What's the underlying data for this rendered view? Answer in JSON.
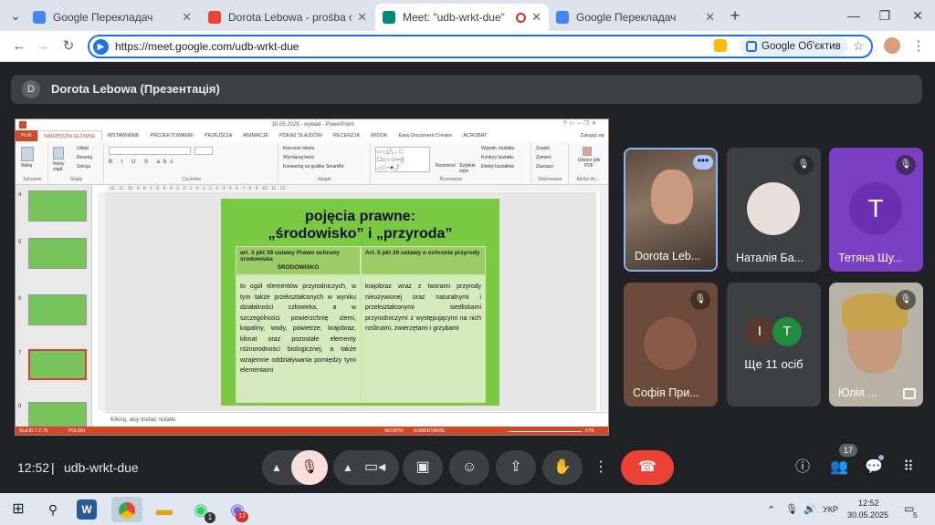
{
  "browser": {
    "tabs": [
      {
        "title": "Google Перекладач",
        "color": "#4285f4"
      },
      {
        "title": "Dorota Lebowa - prośba o można",
        "color": "#ea4335"
      },
      {
        "title": "Meet: \"udb-wrkt-due\"",
        "color": "#00897b"
      },
      {
        "title": "Google Перекладач",
        "color": "#4285f4"
      }
    ],
    "url": "https://meet.google.com/udb-wrkt-due",
    "lens_label": "Google Об'єктив",
    "new_tab": "+",
    "close": "✕"
  },
  "presenter": {
    "initial": "D",
    "name": "Dorota Lebowa (Презентація)"
  },
  "powerpoint": {
    "window_title": "30.05.2025 - wykład - PowerPoint",
    "tabs": [
      "PLIK",
      "NARZĘDZIA GŁÓWNE",
      "WSTAWIANIE",
      "PROJEKTOWANIE",
      "PRZEJŚCIA",
      "ANIMACJE",
      "POKAZ SLAJDÓW",
      "RECENZJA",
      "WIDOK",
      "Easy Document Creator",
      "ACROBAT"
    ],
    "login": "Zaloguj się",
    "ribbon_groups": [
      "Schowek",
      "Slajdy",
      "Czcionka",
      "Akapit",
      "Rysowanie",
      "Edytowanie",
      "Adobe Ac..."
    ],
    "ribbon_buttons": {
      "paste": "Wklej",
      "new_slide": "Nowy slajd",
      "layout": "Układ",
      "reset": "Resetuj",
      "section": "Sekcja",
      "text_direction": "Kierunek tekstu",
      "align_text": "Wyrównaj tekst",
      "smartart": "Konwertuj na grafikę SmartArt",
      "arrange": "Rozmieść",
      "quick_styles": "Szybkie style",
      "fill": "Wypełn. kształtu",
      "outline": "Kontury kształtu",
      "effects": "Efekty kształtów",
      "find": "Znajdź",
      "replace": "Zamień",
      "select": "Zaznacz",
      "pdf": "Utwórz plik PDF"
    },
    "thumbnails": [
      "4",
      "5",
      "6",
      "7",
      "8"
    ],
    "notes_placeholder": "Kliknij, aby dodać notatki",
    "status": {
      "slide": "SLAJD 7 Z 79",
      "lang": "POLSKI",
      "notes": "NOTATKI",
      "comments": "KOMENTARZE",
      "zoom": "67%"
    }
  },
  "slide": {
    "title_line1": "pojęcia prawne:",
    "title_line2": "„środowisko” i „przyroda”",
    "header_left": "art. 3 pkt 39 ustawy Prawo ochrony środowiska",
    "header_left_sub": "ŚRODOWISKO",
    "header_right": "Art. 5 pkt 20 ustawy o ochronie przyrody",
    "body_left": "to ogół elementów przyrodniczych, w tym także przekształconych w wyniku działalności człowieka, a w szczególności powierzchnię ziemi, kopaliny, wody, powietrze, krajobraz, klimat oraz pozostałe elementy różnorodności biologicznej, a także wzajemne oddziaływania pomiędzy tymi elementami",
    "body_right": "krajobraz wraz z tworami przyrody nieożywionej oraz naturalnymi i przekształconymi siedliskami przyrodniczymi z występującymi na nich roślinami, zwierzętami i grzybami"
  },
  "participants": [
    {
      "name": "Dorota Leb...",
      "type": "video"
    },
    {
      "name": "Наталія Ба...",
      "type": "photo",
      "muted": true
    },
    {
      "name": "Тетяна Шу...",
      "type": "initial",
      "initial": "T",
      "muted": true
    },
    {
      "name": "Софія При...",
      "type": "photo",
      "muted": true
    },
    {
      "name": "Ще 11 осіб",
      "type": "more",
      "initials": [
        "I",
        "T"
      ]
    },
    {
      "name": "Юлія ...",
      "type": "video",
      "muted": true
    }
  ],
  "meeting": {
    "time": "12:52",
    "separator": "|",
    "code": "udb-wrkt-due",
    "people_count": "17"
  },
  "colors": {
    "meet_bg": "#202124",
    "tile_bg": "#3c4043",
    "end_call": "#ea4335",
    "mic_off": "#f9dedc",
    "slide_green": "#7ac943",
    "accent_blue": "#1a73e8"
  },
  "taskbar": {
    "lang": "УКР",
    "time": "12:52",
    "date": "30.05.2025",
    "whatsapp_badge": "1",
    "viber_badge": "12",
    "notif_count": "5"
  }
}
